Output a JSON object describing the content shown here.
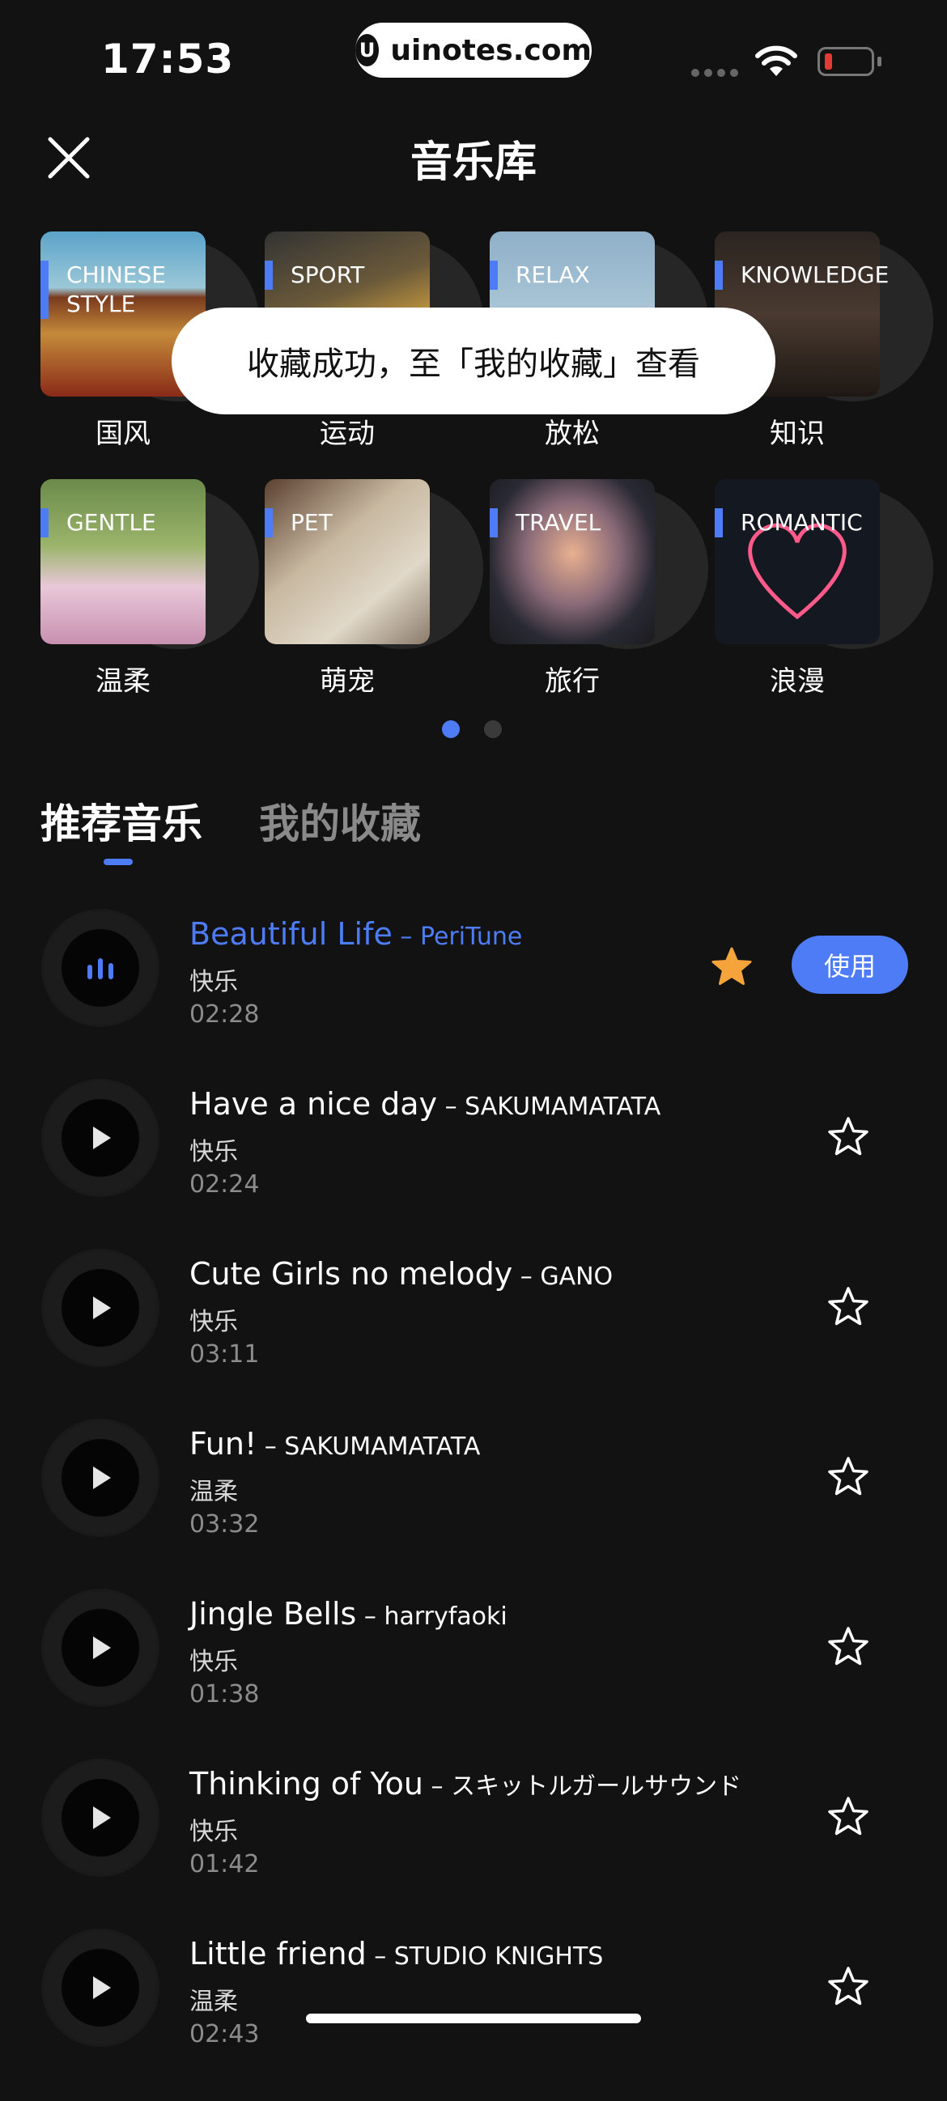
{
  "status": {
    "time": "17:53",
    "url": "uinotes.com"
  },
  "header": {
    "title": "音乐库"
  },
  "categories": [
    {
      "tag": "CHINESE STYLE",
      "name": "国风"
    },
    {
      "tag": "SPORT",
      "name": "运动"
    },
    {
      "tag": "RELAX",
      "name": "放松"
    },
    {
      "tag": "KNOWLEDGE",
      "name": "知识"
    },
    {
      "tag": "GENTLE",
      "name": "温柔"
    },
    {
      "tag": "PET",
      "name": "萌宠"
    },
    {
      "tag": "TRAVEL",
      "name": "旅行"
    },
    {
      "tag": "ROMANTIC",
      "name": "浪漫"
    }
  ],
  "toast": {
    "text": "收藏成功，至「我的收藏」查看"
  },
  "tabs": [
    {
      "label": "推荐音乐",
      "active": true
    },
    {
      "label": "我的收藏",
      "active": false
    }
  ],
  "songs": [
    {
      "title": "Beautiful Life",
      "artist": "PeriTune",
      "genre": "快乐",
      "duration": "02:28",
      "playing": true,
      "favorited": true
    },
    {
      "title": "Have a nice day",
      "artist": "SAKUMAMATATA",
      "genre": "快乐",
      "duration": "02:24",
      "playing": false,
      "favorited": false
    },
    {
      "title": "Cute Girls no melody",
      "artist": "GANO",
      "genre": "快乐",
      "duration": "03:11",
      "playing": false,
      "favorited": false
    },
    {
      "title": "Fun!",
      "artist": "SAKUMAMATATA",
      "genre": "温柔",
      "duration": "03:32",
      "playing": false,
      "favorited": false
    },
    {
      "title": "Jingle Bells",
      "artist": "harryfaoki",
      "genre": "快乐",
      "duration": "01:38",
      "playing": false,
      "favorited": false
    },
    {
      "title": "Thinking of You",
      "artist": "スキットルガールサウンド",
      "genre": "快乐",
      "duration": "01:42",
      "playing": false,
      "favorited": false
    },
    {
      "title": "Little friend",
      "artist": "STUDIO KNIGHTS",
      "genre": "温柔",
      "duration": "02:43",
      "playing": false,
      "favorited": false
    }
  ],
  "use_button": {
    "label": "使用"
  },
  "colors": {
    "accent": "#4e7cf6",
    "favorite": "#f5a33b",
    "background": "#121212"
  },
  "pagination": {
    "current": 1,
    "total": 2
  }
}
